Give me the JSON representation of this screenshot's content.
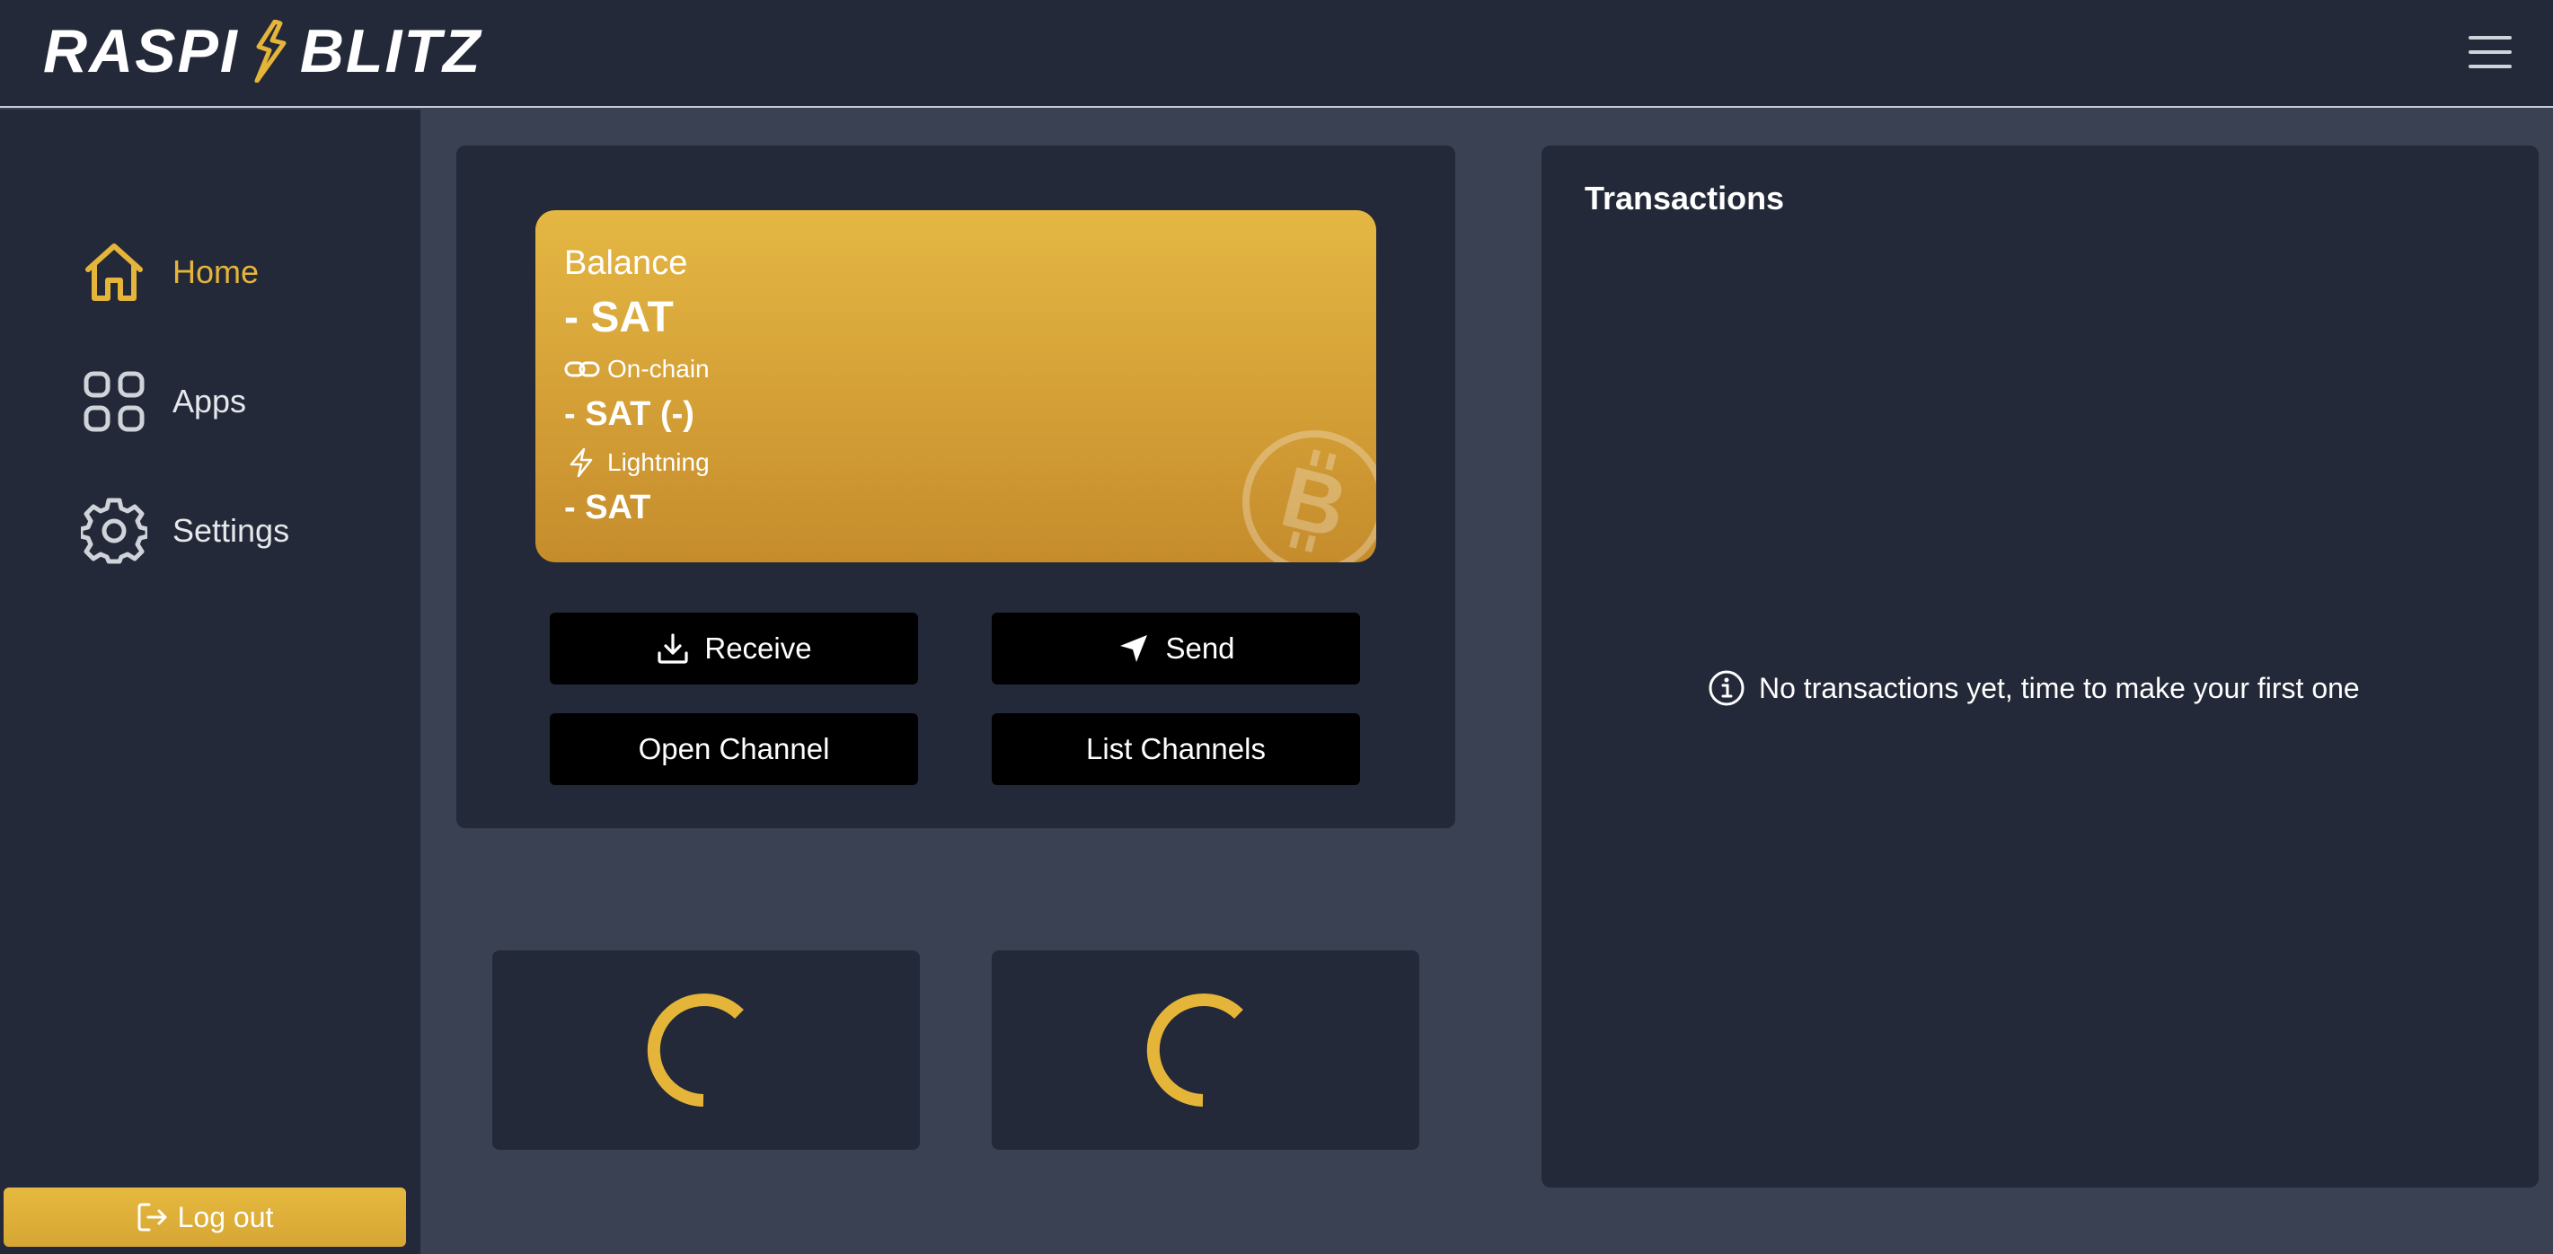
{
  "header": {
    "logo_left": "RASPI",
    "logo_right": "BLITZ"
  },
  "sidebar": {
    "items": [
      {
        "label": "Home",
        "icon": "home-icon",
        "active": true
      },
      {
        "label": "Apps",
        "icon": "apps-grid-icon",
        "active": false
      },
      {
        "label": "Settings",
        "icon": "gear-icon",
        "active": false
      }
    ],
    "logout_label": "Log out"
  },
  "balance": {
    "title": "Balance",
    "total": "- SAT",
    "onchain_label": "On-chain",
    "onchain_value": "- SAT (-)",
    "lightning_label": "Lightning",
    "lightning_value": "- SAT"
  },
  "actions": {
    "receive": "Receive",
    "send": "Send",
    "open_channel": "Open Channel",
    "list_channels": "List Channels"
  },
  "transactions": {
    "title": "Transactions",
    "empty_message": "No transactions yet, time to make your first one"
  },
  "colors": {
    "accent": "#e5b53a",
    "background": "#3a4153",
    "panel": "#232938",
    "button": "#000000"
  }
}
